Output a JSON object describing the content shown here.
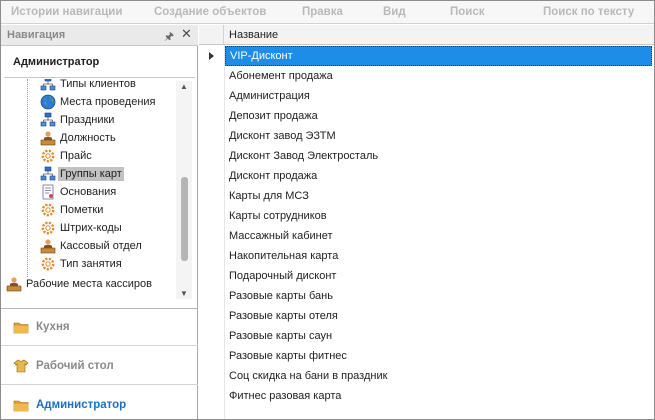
{
  "menu": [
    {
      "label": "Истории навигации"
    },
    {
      "label": "Создание объектов"
    },
    {
      "label": "Правка"
    },
    {
      "label": "Вид"
    },
    {
      "label": "Поиск"
    },
    {
      "label": "Поиск по тексту"
    }
  ],
  "nav": {
    "panel_title": "Навигация",
    "section_title": "Администратор",
    "tree": [
      {
        "label": "Типы клиентов",
        "icon": "network-icon"
      },
      {
        "label": "Места проведения",
        "icon": "globe-icon"
      },
      {
        "label": "Праздники",
        "icon": "network-icon"
      },
      {
        "label": "Должность",
        "icon": "person-desk-icon"
      },
      {
        "label": "Прайс",
        "icon": "gear-icon"
      },
      {
        "label": "Группы карт",
        "icon": "network-icon",
        "selected": true
      },
      {
        "label": "Основания",
        "icon": "document-icon"
      },
      {
        "label": "Пометки",
        "icon": "gear-icon"
      },
      {
        "label": "Штрих-коды",
        "icon": "gear-icon"
      },
      {
        "label": "Кассовый отдел",
        "icon": "person-desk-icon"
      },
      {
        "label": "Тип занятия",
        "icon": "gear-icon"
      },
      {
        "label": "Рабочие места кассиров",
        "icon": "person-desk-icon"
      }
    ],
    "groups": [
      {
        "label": "Кухня",
        "icon": "folder-icon"
      },
      {
        "label": "Рабочий стол",
        "icon": "shirt-icon"
      },
      {
        "label": "Администратор",
        "icon": "folder-icon",
        "active": true
      }
    ]
  },
  "grid": {
    "column_header": "Название",
    "rows": [
      "VIP-Дисконт",
      "Абонемент продажа",
      "Администрация",
      "Депозит продажа",
      "Дисконт завод ЭЗТМ",
      "Дисконт Завод Электросталь",
      "Дисконт продажа",
      "Карты для МСЗ",
      "Карты сотрудников",
      "Массажный кабинет",
      "Накопительная карта",
      "Подарочный дисконт",
      "Разовые карты бань",
      "Разовые карты отеля",
      "Разовые карты саун",
      "Разовые карты фитнес",
      "Соц скидка на бани в праздник",
      "Фитнес разовая карта"
    ],
    "selected_index": 0
  },
  "colors": {
    "selection": "#1e8de8",
    "active_group": "#1b6fc7",
    "disabled_menu": "#b9b9b9"
  }
}
